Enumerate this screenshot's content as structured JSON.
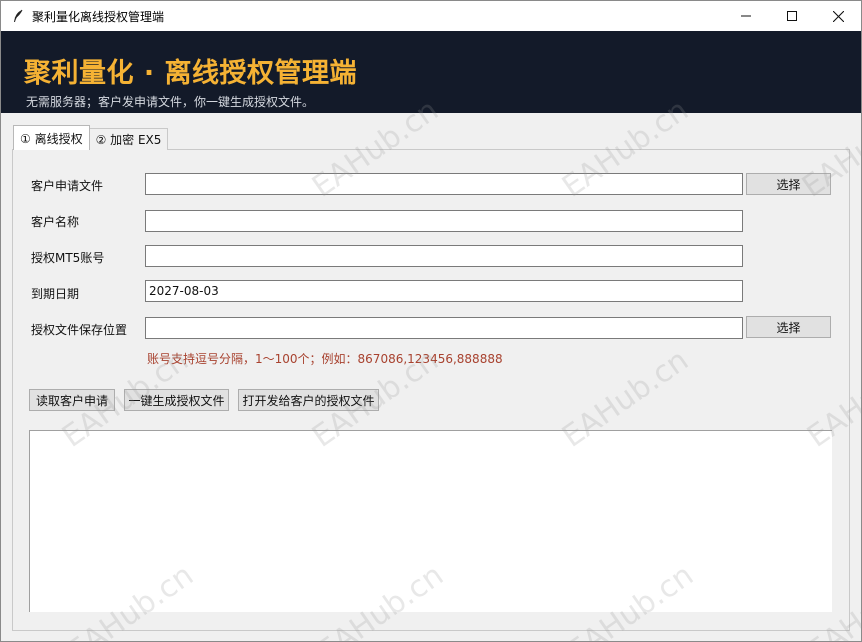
{
  "window": {
    "title": "聚利量化离线授权管理端",
    "icon": "feather-icon"
  },
  "banner": {
    "title": "聚利量化 · 离线授权管理端",
    "subtitle": "无需服务器；客户发申请文件，你一键生成授权文件。"
  },
  "tabs": [
    {
      "label": "① 离线授权",
      "active": true
    },
    {
      "label": "② 加密 EX5",
      "active": false
    }
  ],
  "form": {
    "request_file_label": "客户申请文件",
    "request_file_value": "",
    "customer_name_label": "客户名称",
    "customer_name_value": "",
    "account_label": "授权MT5账号",
    "account_value": "",
    "expiry_label": "到期日期",
    "expiry_value": "2027-08-03",
    "save_location_label": "授权文件保存位置",
    "save_location_value": "",
    "browse_label": "选择",
    "hint": "账号支持逗号分隔，1～100个；例如：867086,123456,888888"
  },
  "actions": {
    "read_request": "读取客户申请",
    "generate": "一键生成授权文件",
    "open_folder": "打开发给客户的授权文件"
  },
  "log": "",
  "watermark": "EAHub.cn",
  "colors": {
    "banner_bg": "#131a29",
    "banner_title": "#f5b234",
    "hint": "#a8422f"
  }
}
